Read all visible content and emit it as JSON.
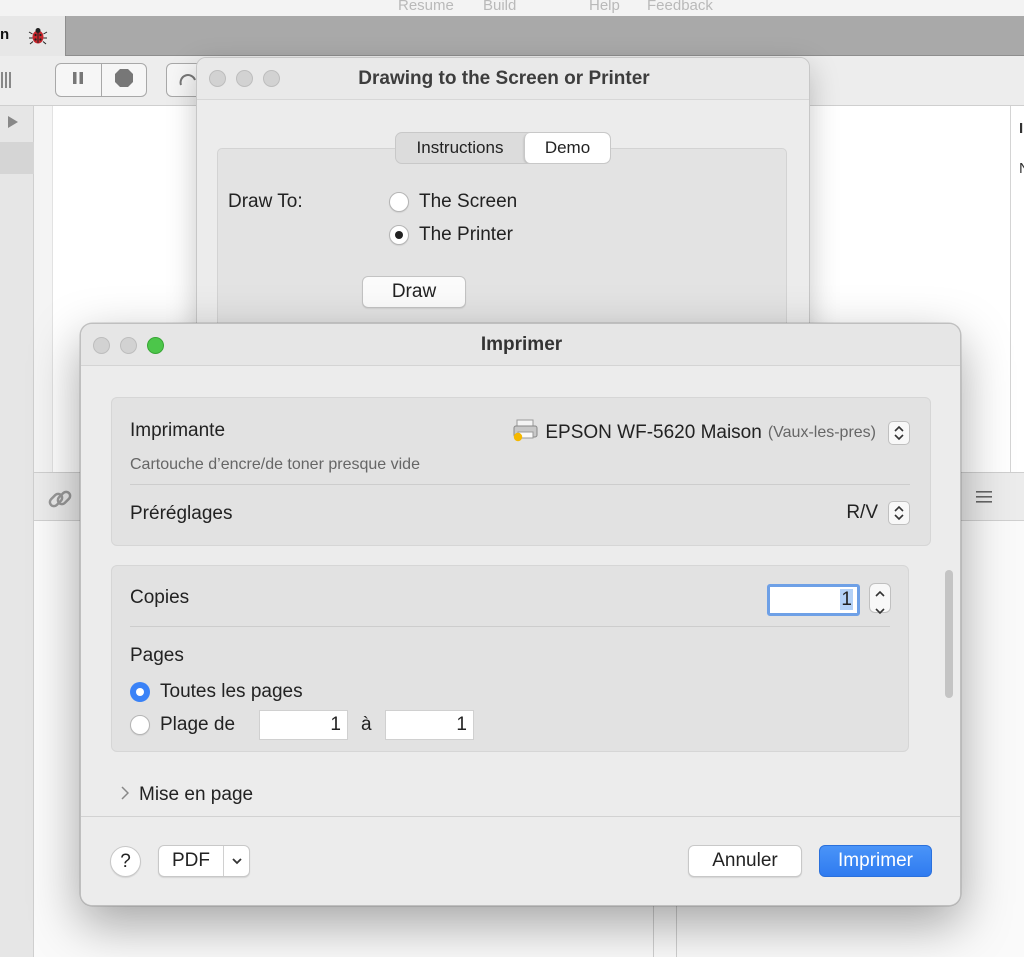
{
  "menubar": {
    "items": [
      "Resume",
      "Build",
      "Help",
      "Feedback"
    ]
  },
  "ide": {
    "tab_label": "n",
    "inspector_cut_1": "I",
    "inspector_cut_2": "N"
  },
  "demo_window": {
    "title": "Drawing to the Screen or Printer",
    "tabs": [
      {
        "label": "Instructions"
      },
      {
        "label": "Demo"
      }
    ],
    "selected_tab": "Demo",
    "draw_to_label": "Draw To:",
    "options": [
      {
        "label": "The Screen"
      },
      {
        "label": "The Printer"
      }
    ],
    "selected_option": "The Printer",
    "draw_button": "Draw"
  },
  "print_dialog": {
    "title": "Imprimer",
    "printer_label": "Imprimante",
    "printer_name": "EPSON WF-5620 Maison",
    "printer_location": "(Vaux-les-pres)",
    "printer_status": "Cartouche d’encre/de toner presque vide",
    "presets_label": "Préréglages",
    "presets_value": "R/V",
    "copies_label": "Copies",
    "copies_value": "1",
    "pages_label": "Pages",
    "all_pages_label": "Toutes les pages",
    "range_label": "Plage de",
    "range_from": "1",
    "range_to_label": "à",
    "range_to": "1",
    "selected_pages_option": "Toutes les pages",
    "layout_section": "Mise en page",
    "help_button": "?",
    "pdf_button": "PDF",
    "cancel_button": "Annuler",
    "print_button": "Imprimer"
  },
  "colors": {
    "accent": "#3a82f7",
    "close": "#ff5f57",
    "minimize": "#febc2e",
    "zoom": "#4cc64a"
  }
}
